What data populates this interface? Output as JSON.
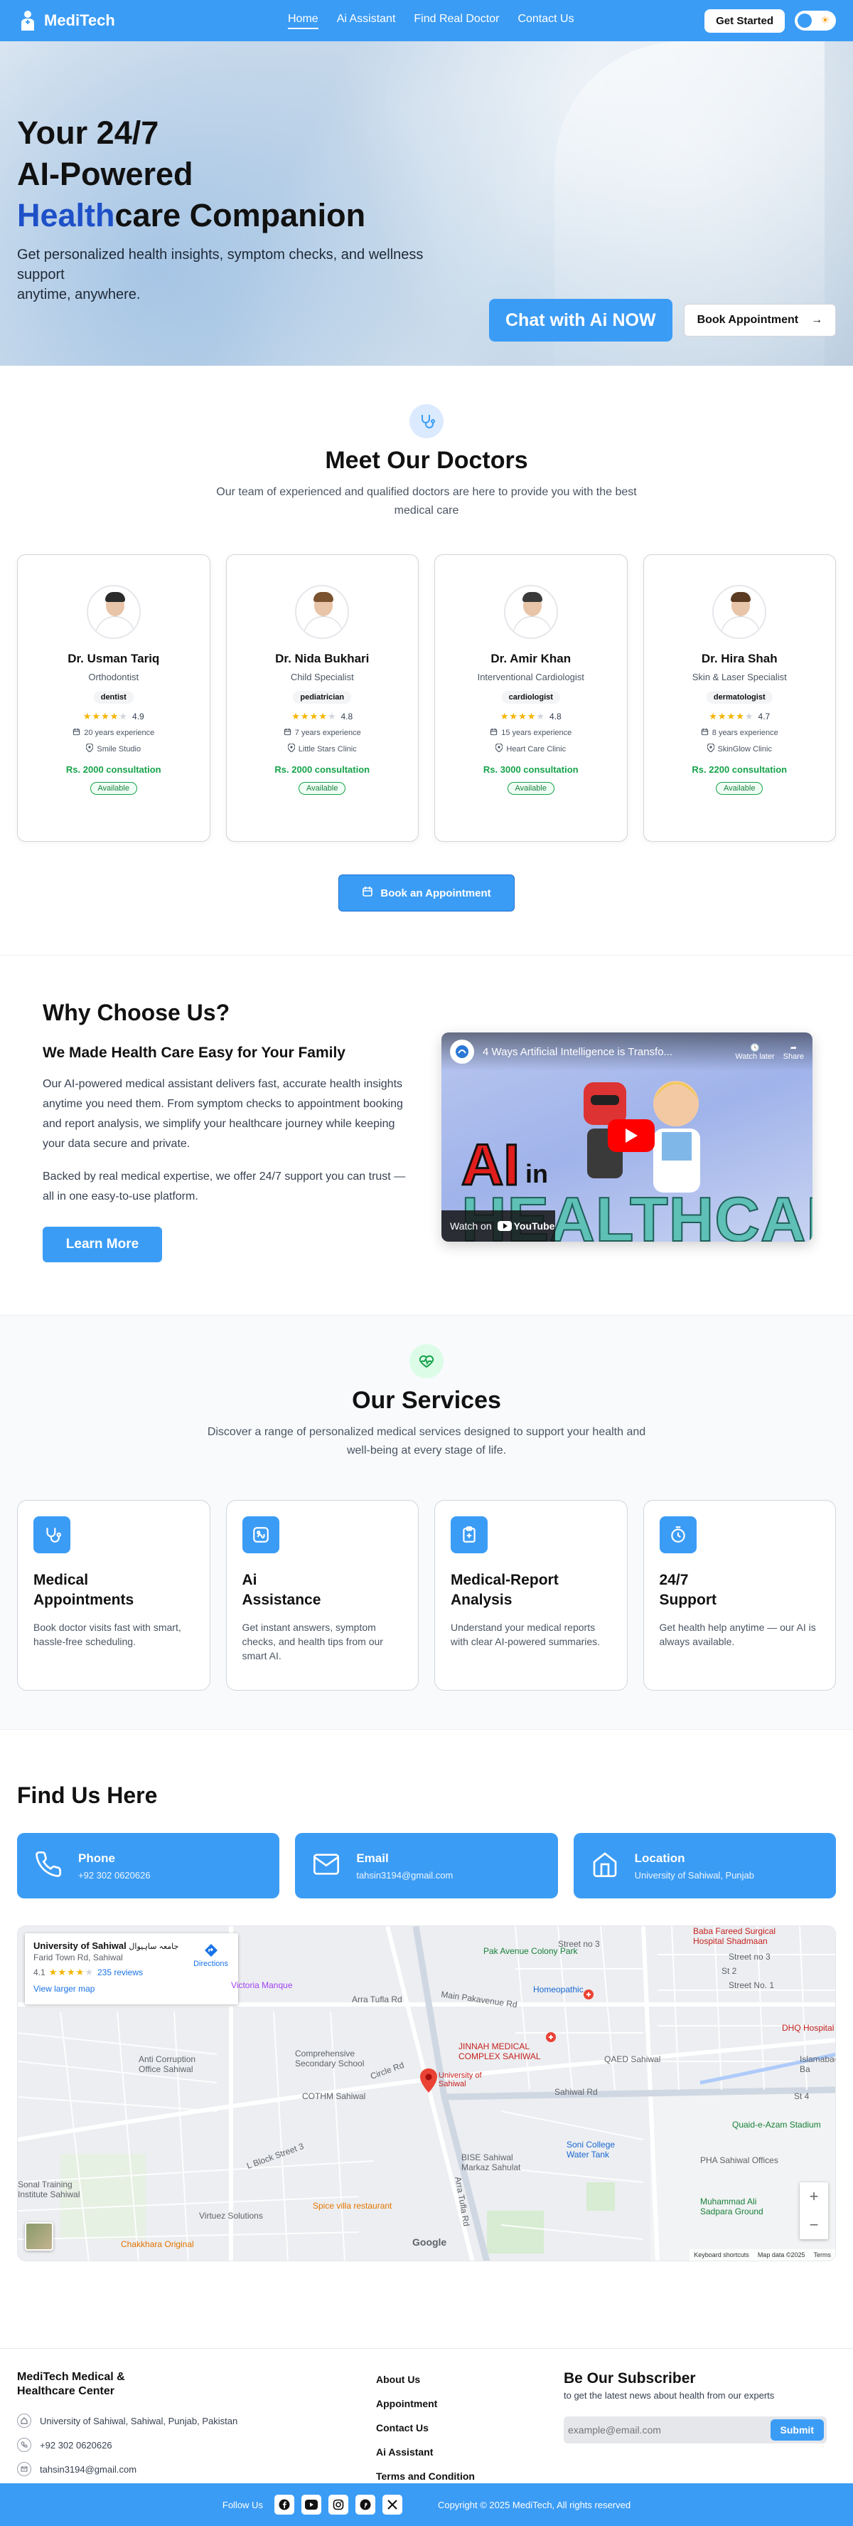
{
  "nav": {
    "brand": "MediTech",
    "links": [
      {
        "label": "Home",
        "active": true
      },
      {
        "label": "Ai Assistant"
      },
      {
        "label": "Find Real Doctor"
      },
      {
        "label": "Contact Us"
      }
    ],
    "get_started": "Get Started",
    "theme_icon": "sun-icon"
  },
  "hero": {
    "title_line1": "Your 24/7",
    "title_line2": "AI-Powered",
    "title_accent": "Health",
    "title_rest": "care Companion",
    "subtitle_line1": "Get personalized health insights, symptom checks, and wellness support",
    "subtitle_line2": "anytime, anywhere.",
    "chat_button": "Chat with Ai NOW",
    "book_button": "Book Appointment"
  },
  "doctors": {
    "title": "Meet Our Doctors",
    "description": "Our team of experienced and qualified doctors are here to provide you with the best medical care",
    "items": [
      {
        "name": "Dr. Usman Tariq",
        "specialty": "Orthodontist",
        "tag": "dentist",
        "rating": "4.9",
        "stars": 4,
        "experience": "20 years experience",
        "clinic": "Smile Studio",
        "fee": "Rs. 2000 consultation",
        "status": "Available",
        "hair": "#2b2b2b"
      },
      {
        "name": "Dr. Nida Bukhari",
        "specialty": "Child Specialist",
        "tag": "pediatrician",
        "rating": "4.8",
        "stars": 4,
        "experience": "7 years experience",
        "clinic": "Little Stars Clinic",
        "fee": "Rs. 2000 consultation",
        "status": "Available",
        "hair": "#7a5230"
      },
      {
        "name": "Dr. Amir Khan",
        "specialty": "Interventional Cardiologist",
        "tag": "cardiologist",
        "rating": "4.8",
        "stars": 4,
        "experience": "15 years experience",
        "clinic": "Heart Care Clinic",
        "fee": "Rs. 3000 consultation",
        "status": "Available",
        "hair": "#3a3a3a"
      },
      {
        "name": "Dr. Hira Shah",
        "specialty": "Skin & Laser Specialist",
        "tag": "dermatologist",
        "rating": "4.7",
        "stars": 4,
        "experience": "8 years experience",
        "clinic": "SkinGlow Clinic",
        "fee": "Rs. 2200 consultation",
        "status": "Available",
        "hair": "#5a3b22"
      }
    ],
    "book_button": "Book an Appointment"
  },
  "why": {
    "title": "Why Choose Us?",
    "subtitle": "We Made Health Care Easy for Your Family",
    "para1": "Our AI-powered medical assistant delivers fast, accurate health insights anytime you need them. From symptom checks to appointment booking and report analysis, we simplify your healthcare journey while keeping your data secure and private.",
    "para2": "Backed by real medical expertise, we offer 24/7 support you can trust — all in one easy-to-use platform.",
    "learn_more": "Learn More",
    "video": {
      "title": "4 Ways Artificial Intelligence is Transfo...",
      "watch_later": "Watch later",
      "share": "Share",
      "big_ai": "AI",
      "big_in": "in",
      "big_healthcare": "HEALTHCARE",
      "watch_on": "Watch on",
      "youtube": "YouTube"
    }
  },
  "services": {
    "title": "Our Services",
    "description": "Discover a range of personalized medical services designed to support your health and well-being at every stage of life.",
    "items": [
      {
        "title_line1": "Medical",
        "title_line2": "Appointments",
        "desc": "Book doctor visits fast with smart, hassle-free scheduling.",
        "icon": "stethoscope-icon"
      },
      {
        "title_line1": "Ai",
        "title_line2": "Assistance",
        "desc": "Get instant answers, symptom checks, and health tips from our smart AI.",
        "icon": "medical-bot-icon"
      },
      {
        "title_line1": "Medical-Report",
        "title_line2": "Analysis",
        "desc": "Understand your medical reports with clear AI-powered summaries.",
        "icon": "clipboard-icon"
      },
      {
        "title_line1": "24/7",
        "title_line2": "Support",
        "desc": "Get health help anytime — our AI is always available.",
        "icon": "clock-icon"
      }
    ]
  },
  "find": {
    "title": "Find Us Here",
    "contacts": [
      {
        "label": "Phone",
        "value": "+92 302 0620626",
        "icon": "phone-icon"
      },
      {
        "label": "Email",
        "value": "tahsin3194@gmail.com",
        "icon": "mail-icon"
      },
      {
        "label": "Location",
        "value": "University of Sahiwal, Punjab",
        "icon": "home-icon"
      }
    ],
    "map": {
      "place_title": "University of Sahiwal",
      "place_title_ur": "جامعہ ساہیوال",
      "address": "Farid Town Rd, Sahiwal",
      "rating": "4.1",
      "reviews": "235 reviews",
      "larger_map": "View larger map",
      "directions": "Directions",
      "labels": {
        "pak_avenue": "Pak Avenue Colony Park",
        "homeopathic": "Homeopathic",
        "victoria": "Victoria Manque",
        "arra_tufla": "Arra Tufla Rd",
        "main_pakavenue": "Main Pakavenue Rd",
        "anti_corruption": "Anti Corruption Office Sahiwal",
        "comprehensive": "Comprehensive Secondary School",
        "jinnah": "JINNAH MEDICAL COMPLEX SAHIWAL",
        "qaed": "QAED Sahiwal",
        "cotsm": "COTHM Sahiwal",
        "uni_pin": "University of Sahiwal",
        "bise": "BISE Sahiwal Markaz Sahulat",
        "soni_college": "Soni College Water Tank",
        "quaid": "Quaid-e-Azam Stadium",
        "pha": "PHA Sahiwal Offices",
        "muhammad_ali": "Muhammad Ali Sadpara Ground",
        "spice_villa": "Spice villa restaurant",
        "chakkhara": "Chakkhara Original",
        "virtuez": "Virtuez Solutions",
        "sonal_training": "Sonal Training Institute Sahiwal",
        "baba_fareed": "Baba Fareed Surgical Hospital Shadmaan",
        "dhq": "DHQ Hospital",
        "islamabad": "Islamabad Ba",
        "sahiwal_rd": "Sahiwal Rd",
        "circle_rd": "Circle Rd",
        "lblock": "L Block Street 3",
        "arra_tufla_rd": "Arra Tufla Rd",
        "street3": "Street no 3",
        "st3": "Street no 3",
        "st2": "St 2",
        "st1": "Street No. 1",
        "st4": "St 4"
      },
      "google": "Google",
      "footer_shortcuts": "Keyboard shortcuts",
      "footer_data": "Map data ©2025",
      "footer_terms": "Terms"
    }
  },
  "footer": {
    "brand_line1": "MediTech Medical &",
    "brand_line2": "Healthcare Center",
    "address": "University of Sahiwal, Sahiwal, Punjab, Pakistan",
    "phone": "+92 302 0620626",
    "email": "tahsin3194@gmail.com",
    "links": [
      "About Us",
      "Appointment",
      "Contact Us",
      "Ai Assistant",
      "Terms and Condition"
    ],
    "subscribe_title": "Be Our Subscriber",
    "subscribe_text": "to get the latest news about health from our experts",
    "email_placeholder": "example@email.com",
    "submit": "Submit"
  },
  "bottombar": {
    "follow": "Follow Us",
    "social": [
      "facebook-icon",
      "youtube-icon",
      "instagram-icon",
      "pinterest-icon",
      "x-icon"
    ],
    "copyright": "Copyright © 2025 MediTech, All rights reserved"
  },
  "colors": {
    "primary": "#3b9cf5",
    "accent_text": "#1e50c8",
    "success": "#16a34a",
    "star": "#f5b400"
  }
}
